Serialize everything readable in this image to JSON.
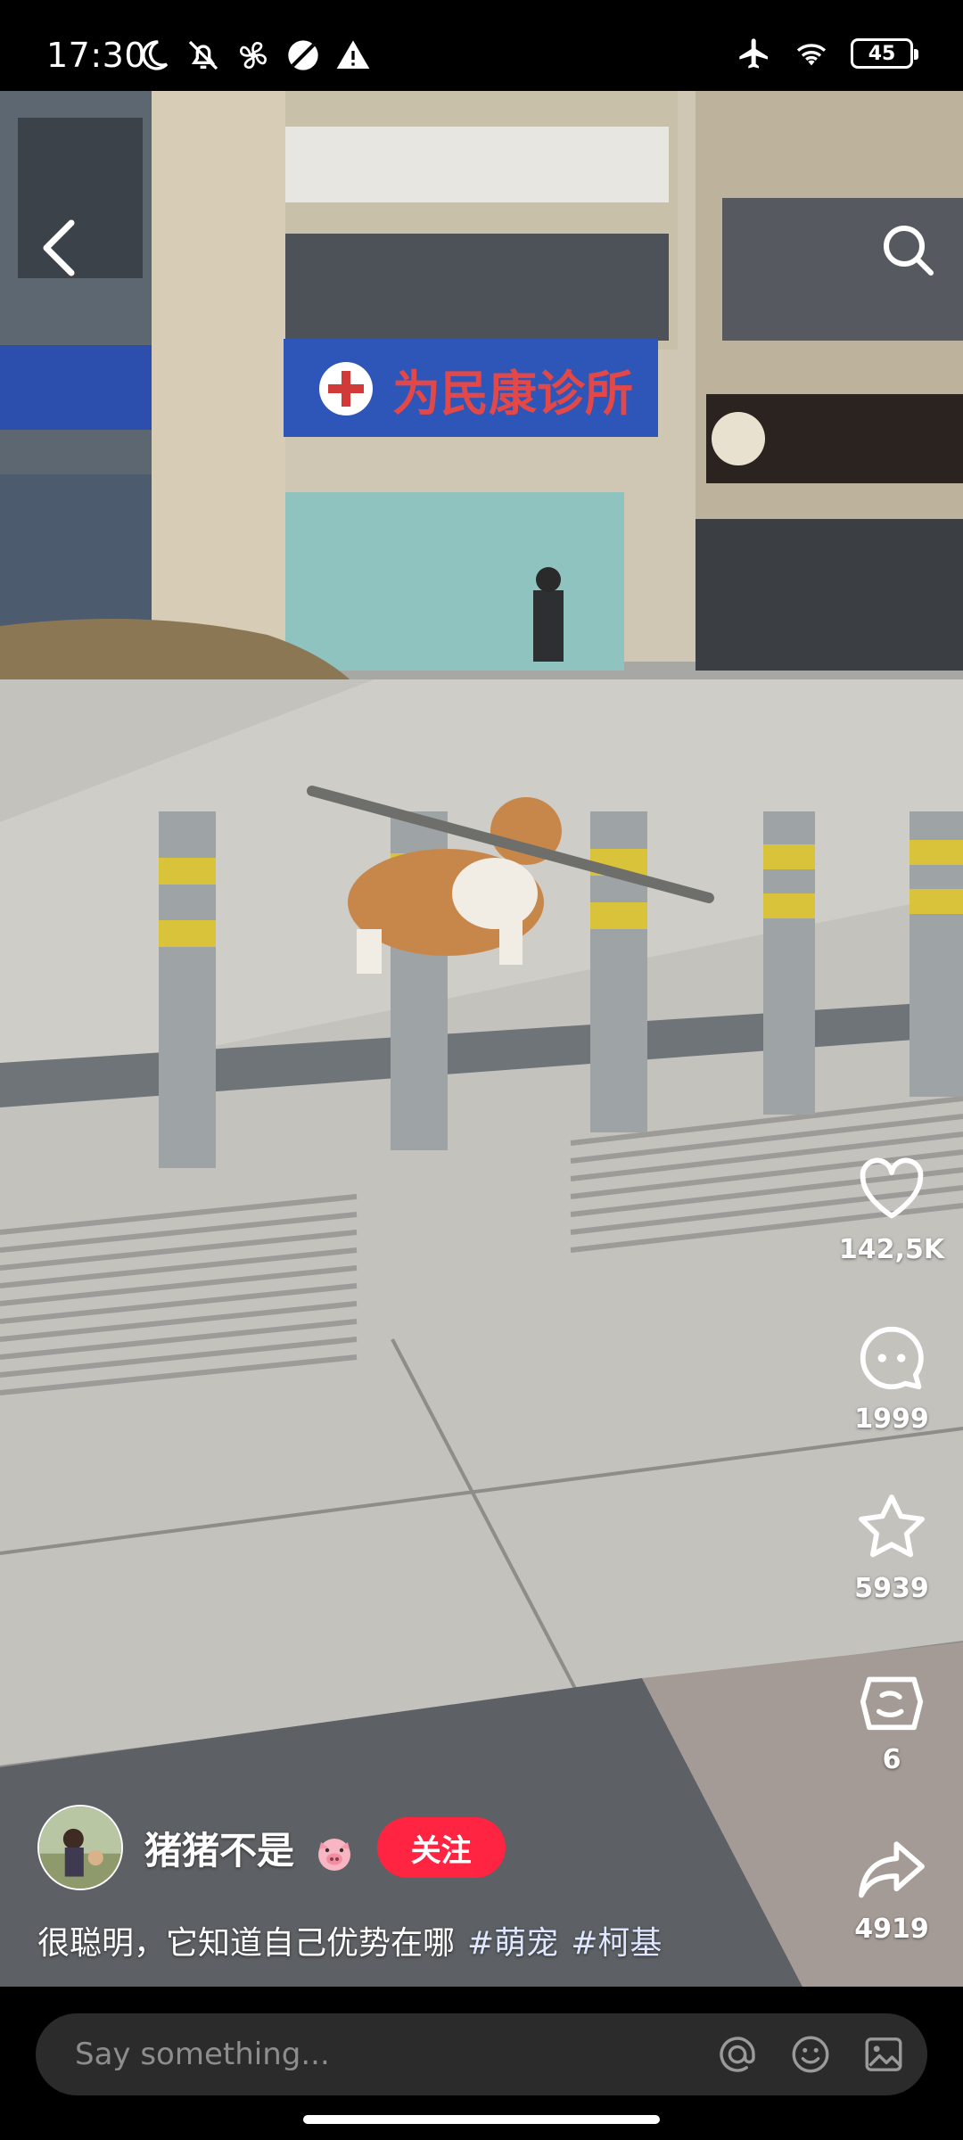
{
  "status_bar": {
    "time": "17:30",
    "battery": "45",
    "icons_left": [
      "moon-icon",
      "bell-off-icon",
      "fan-icon",
      "no-sim-icon",
      "warning-icon"
    ],
    "icons_right": [
      "airplane-icon",
      "wifi-icon",
      "battery-icon"
    ]
  },
  "video": {
    "sign_text": "为民康诊所"
  },
  "actions": {
    "likes": "142,5K",
    "comments": "1999",
    "favorites": "5939",
    "gifts": "6",
    "shares": "4919"
  },
  "author": {
    "name": "猪猪不是",
    "follow_label": "关注"
  },
  "caption": {
    "text": "很聪明，它知道自己优势在哪",
    "tags": [
      "#萌宠",
      "#柯基"
    ]
  },
  "comment_bar": {
    "placeholder": "Say something..."
  },
  "colors": {
    "accent": "#ff2442",
    "background": "#000000",
    "input": "#2b2b2b"
  }
}
